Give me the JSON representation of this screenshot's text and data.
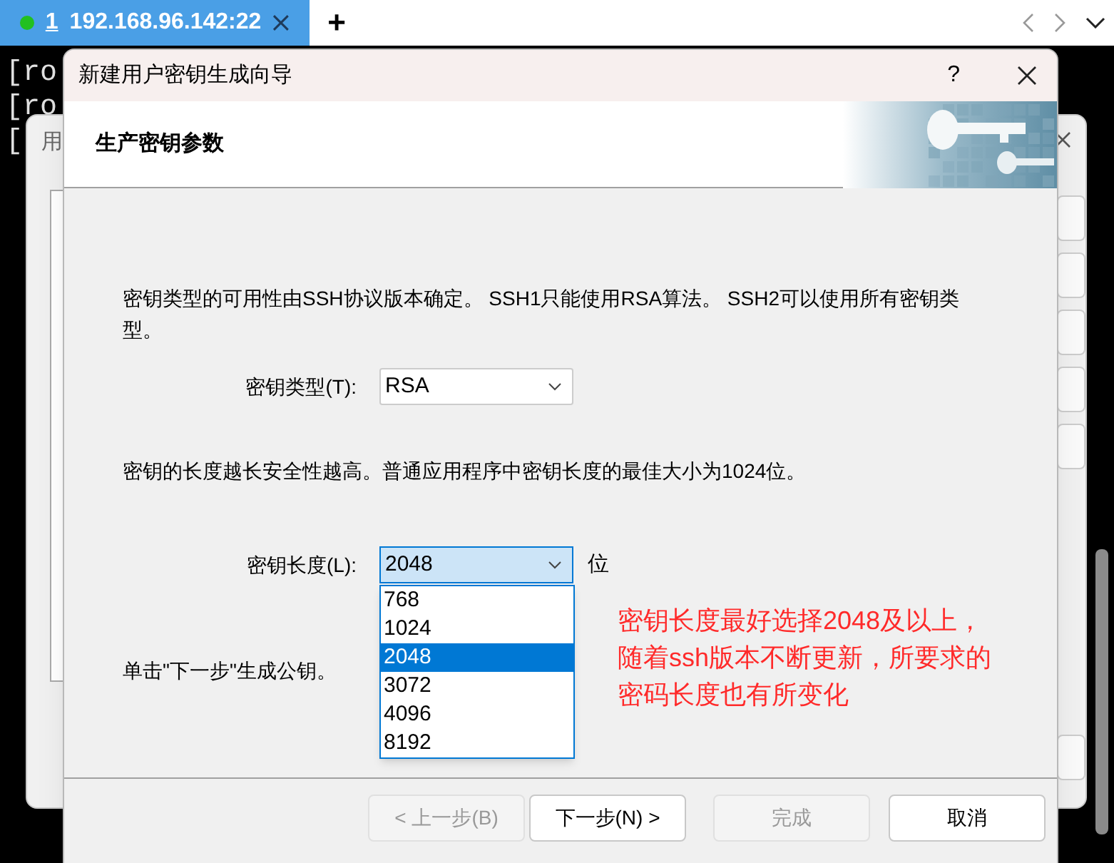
{
  "tab_bar": {
    "tabs": [
      {
        "index": "1",
        "title": "192.168.96.142:22",
        "selected": true,
        "connected": true
      }
    ],
    "new_tab": "+"
  },
  "terminal": {
    "lines": [
      "[ro",
      "[ro",
      "["
    ]
  },
  "back_dialog": {
    "title": "用"
  },
  "dialog": {
    "title": "新建用户密钥生成向导",
    "help": "?",
    "header": "生产密钥参数",
    "intro": "密钥类型的可用性由SSH协议版本确定。 SSH1只能使用RSA算法。 SSH2可以使用所有密钥类型。",
    "key_type": {
      "label": "密钥类型(T):",
      "value": "RSA"
    },
    "length_note": "密钥的长度越长安全性越高。普通应用程序中密钥长度的最佳大小为1024位。",
    "key_length": {
      "label": "密钥长度(L):",
      "value": "2048",
      "unit": "位",
      "expanded": true,
      "options": [
        {
          "label": "768",
          "selected": false
        },
        {
          "label": "1024",
          "selected": false
        },
        {
          "label": "2048",
          "selected": true
        },
        {
          "label": "3072",
          "selected": false
        },
        {
          "label": "4096",
          "selected": false
        },
        {
          "label": "8192",
          "selected": false
        }
      ]
    },
    "hint": "单击\"下一步\"生成公钥。",
    "buttons": [
      {
        "label": "< 上一步(B)",
        "disabled": true
      },
      {
        "label": "下一步(N) >",
        "disabled": false
      },
      {
        "label": "完成",
        "disabled": true
      },
      {
        "label": "取消",
        "disabled": false
      }
    ]
  },
  "annotation": {
    "lines": [
      "密钥长度最好选择2048及以上，",
      "随着ssh版本不断更新，所要求的",
      "密码长度也有所变化"
    ]
  }
}
